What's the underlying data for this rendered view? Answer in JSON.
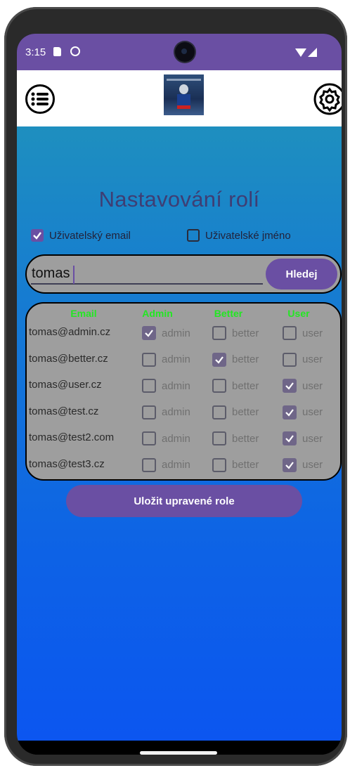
{
  "status": {
    "time": "3:15"
  },
  "page": {
    "title": "Nastavování rolí"
  },
  "search_options": [
    {
      "label": "Uživatelský email",
      "checked": true
    },
    {
      "label": "Uživatelské jméno",
      "checked": false
    }
  ],
  "search": {
    "value": "tomas",
    "button_label": "Hledej"
  },
  "table": {
    "headers": [
      "Email",
      "Admin",
      "Better",
      "User"
    ],
    "role_labels": [
      "admin",
      "better",
      "user"
    ],
    "rows": [
      {
        "email": "tomas@admin.cz",
        "admin": true,
        "better": false,
        "user": false
      },
      {
        "email": "tomas@better.cz",
        "admin": false,
        "better": true,
        "user": false
      },
      {
        "email": "tomas@user.cz",
        "admin": false,
        "better": false,
        "user": true
      },
      {
        "email": "tomas@test.cz",
        "admin": false,
        "better": false,
        "user": true
      },
      {
        "email": "tomas@test2.com",
        "admin": false,
        "better": false,
        "user": true
      },
      {
        "email": "tomas@test3.cz",
        "admin": false,
        "better": false,
        "user": true
      }
    ]
  },
  "actions": {
    "save_label": "Uložit upravené role"
  },
  "colors": {
    "accent": "#6a4fa3",
    "header_green": "#22e822",
    "panel_gray": "#9e9e9e"
  },
  "icons": {
    "menu": "list-menu-icon",
    "settings": "gear-icon",
    "check": "check-icon"
  }
}
